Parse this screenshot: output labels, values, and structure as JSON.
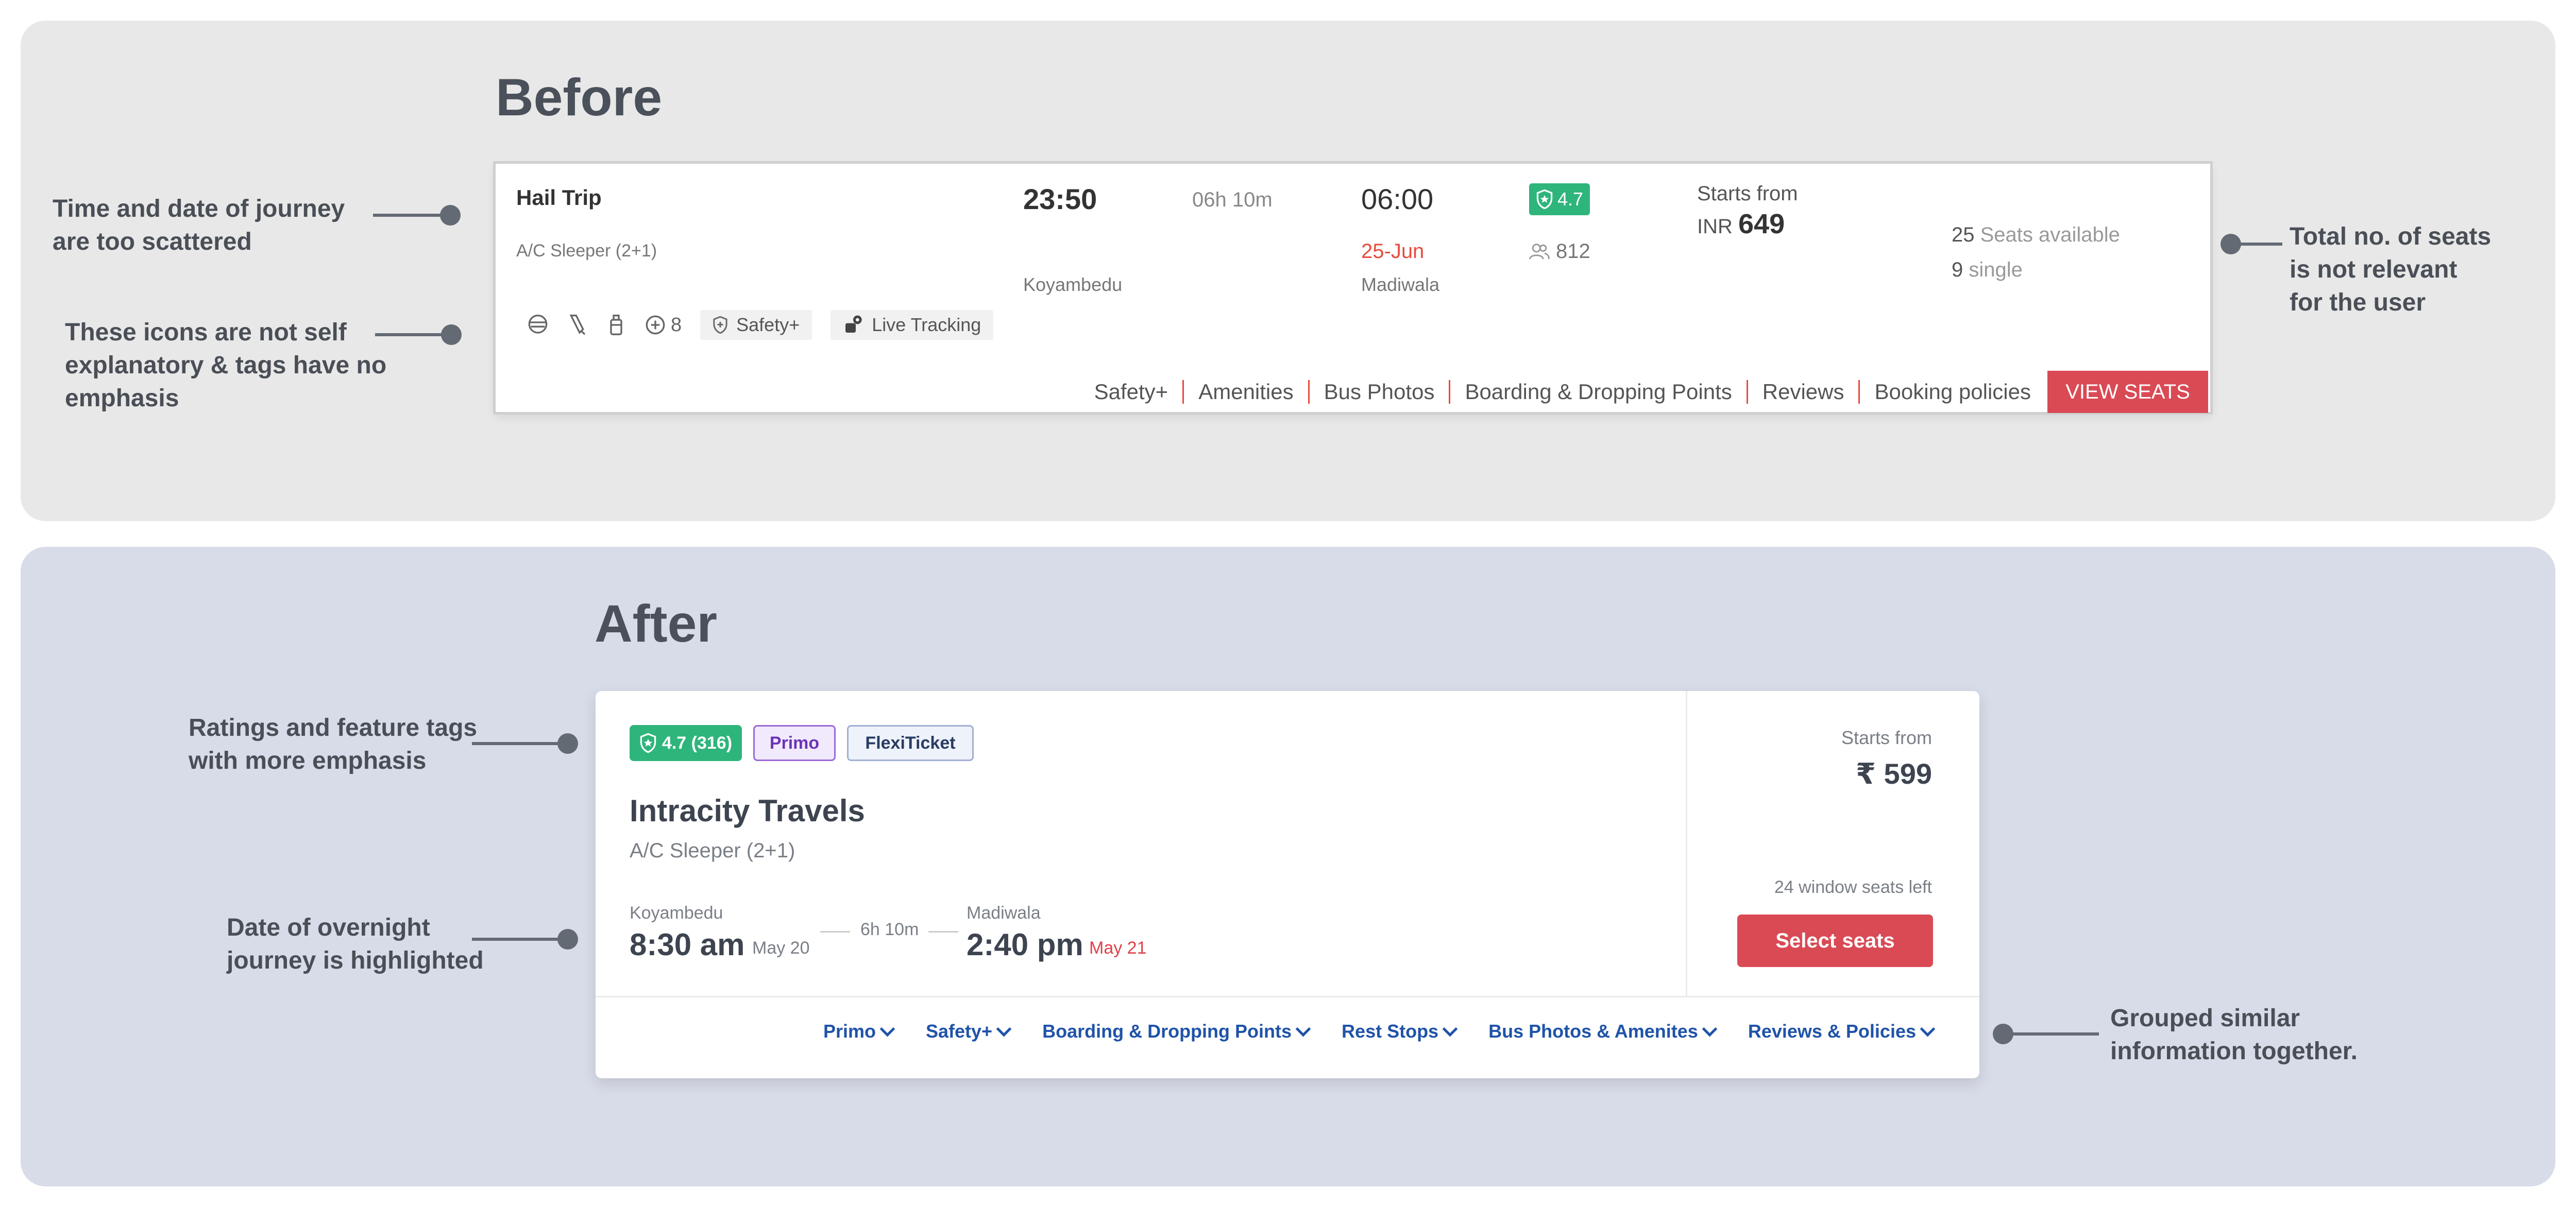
{
  "before": {
    "title": "Before",
    "notes": {
      "time": "Time and date of journey\nare too scattered",
      "icons": "These icons are not self\nexplanatory & tags have no\nemphasis",
      "seats": "Total no. of seats\nis not relevant\nfor the user"
    },
    "card": {
      "operator": "Hail Trip",
      "bus_type": "A/C Sleeper (2+1)",
      "departure_time": "23:50",
      "duration": "06h 10m",
      "arrival_time": "06:00",
      "arrival_date": "25-Jun",
      "from": "Koyambedu",
      "to": "Madiwala",
      "rating": "4.7",
      "reviews": "812",
      "starts_from": "Starts from",
      "currency": "INR",
      "price": "649",
      "seats_count": "25",
      "seats_label": "Seats available",
      "single_count": "9",
      "single_label": "single",
      "amenity_extra": "8",
      "tags": [
        "Safety+",
        "Live Tracking"
      ],
      "links": [
        "Safety+",
        "Amenities",
        "Bus Photos",
        "Boarding & Dropping Points",
        "Reviews",
        "Booking policies"
      ],
      "view_button": "VIEW SEATS"
    }
  },
  "after": {
    "title": "After",
    "notes": {
      "ratings": "Ratings and feature tags\nwith more emphasis",
      "date": "Date of overnight\njourney is highlighted",
      "grouped": "Grouped similar\ninformation together."
    },
    "card": {
      "rating": "4.7 (316)",
      "tag_primo": "Primo",
      "tag_flexi": "FlexiTicket",
      "operator": "Intracity Travels",
      "bus_type": "A/C Sleeper (2+1)",
      "from": "Koyambedu",
      "departure_time": "8:30 am",
      "departure_date": "May 20",
      "duration": "6h 10m",
      "to": "Madiwala",
      "arrival_time": "2:40 pm",
      "arrival_date": "May 21",
      "starts_from": "Starts from",
      "price": "₹ 599",
      "window_seats": "24 window seats left",
      "select_button": "Select seats",
      "links": [
        "Primo",
        "Safety+",
        "Boarding & Dropping Points",
        "Rest Stops",
        "Bus Photos & Amenites",
        "Reviews & Policies"
      ]
    }
  },
  "colors": {
    "accent_red": "#d94a55",
    "rating_green": "#2eb57b",
    "link_blue": "#1f53a8"
  }
}
